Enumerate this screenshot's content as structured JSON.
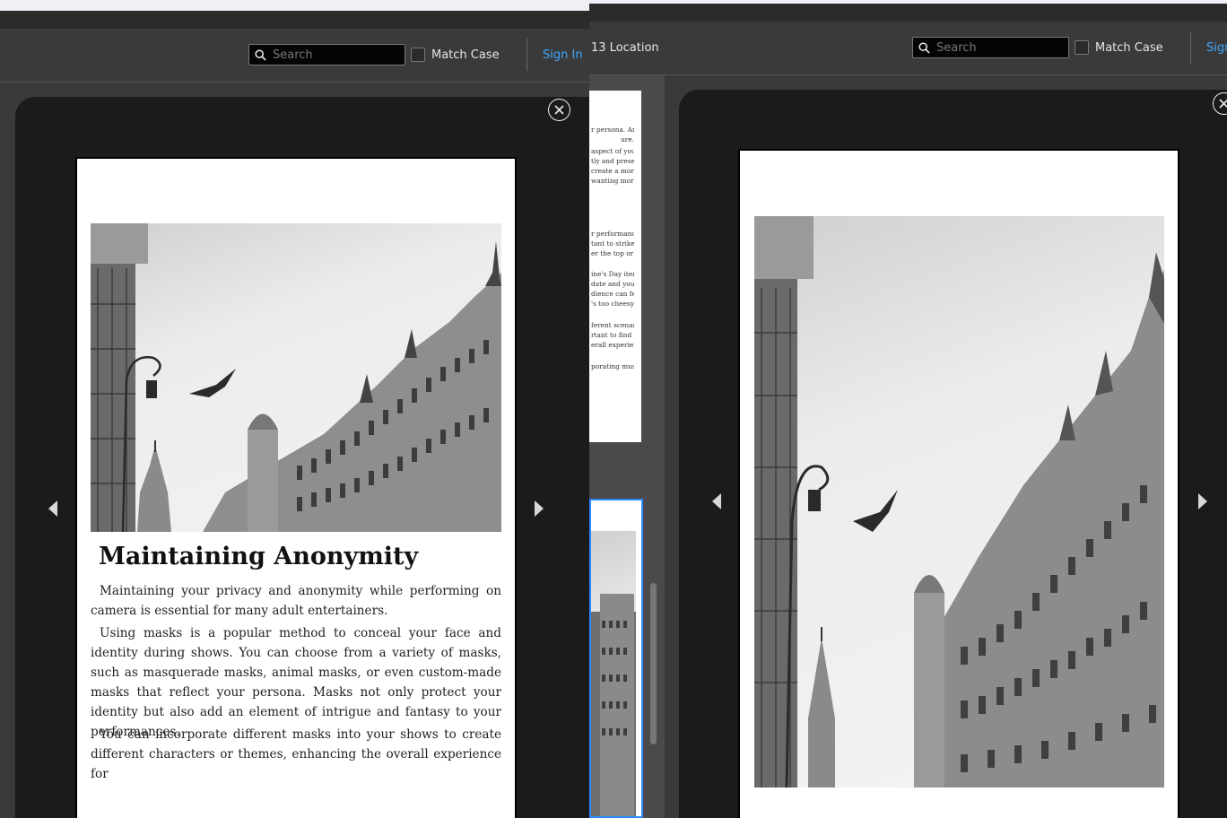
{
  "left_window": {
    "toolbar": {
      "search_placeholder": "Search",
      "match_case_label": "Match Case",
      "sign_in_label": "Sign In"
    },
    "page": {
      "heading": "Maintaining Anonymity",
      "paragraphs": [
        "Maintaining your privacy and anonymity while performing on camera is essential for many adult entertainers.",
        "Using masks is a popular method to conceal your face and identity during shows. You can choose from a variety of masks, such as masquerade masks, animal masks, or even custom-made masks that reflect your persona. Masks not only protect your identity but also add an element of intrigue and fantasy to your performances.",
        "You can incorporate different masks into your shows to create different characters or themes, enhancing the overall experience for"
      ]
    }
  },
  "right_window": {
    "toolbar": {
      "location_label": "13 Location",
      "search_placeholder": "Search",
      "match_case_label": "Match Case",
      "sign_in_label": "Sign"
    },
    "thumbnail_text": [
      "r persona. And",
      "ure.",
      "aspect of your",
      "tly and present",
      "create a more",
      "wanting more.",
      "r performances",
      "tant to strike a",
      "er the top or too",
      "ine's Day items,",
      "date and your",
      "dience can feel",
      "'s too cheesy or",
      "ferent scenarios",
      "rtant to find a",
      "erall experience",
      "porating music,"
    ]
  }
}
